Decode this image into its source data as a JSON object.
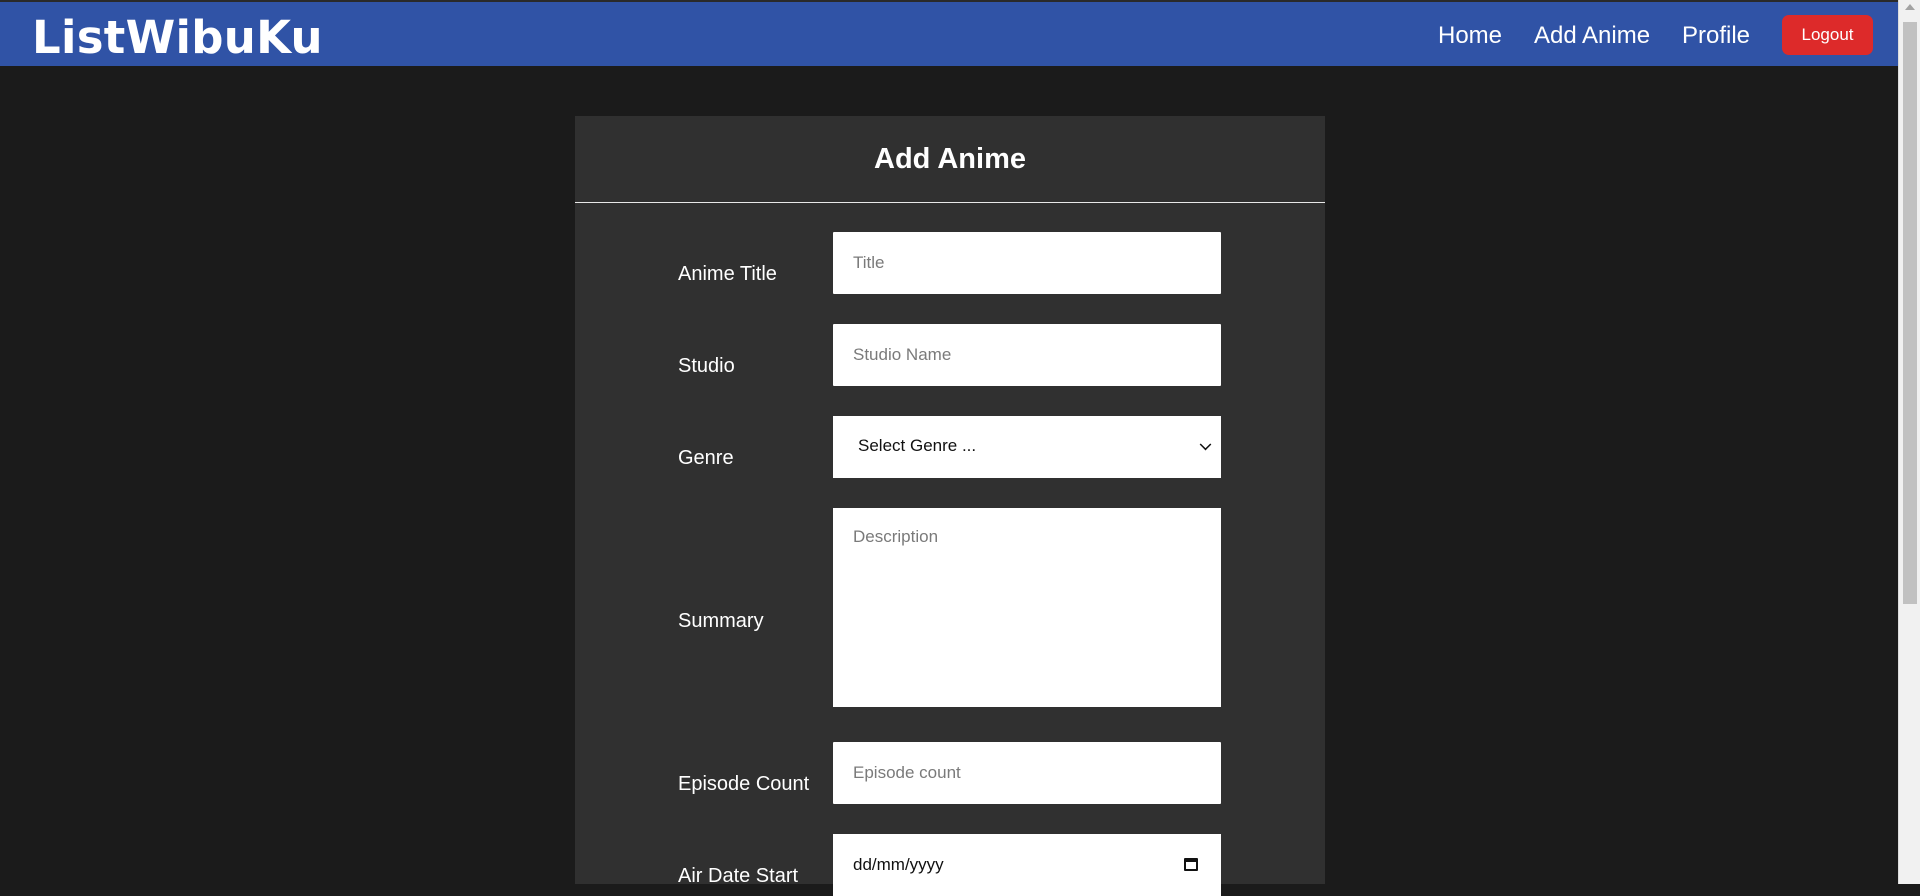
{
  "navbar": {
    "brand": "ListWibuKu",
    "links": [
      "Home",
      "Add Anime",
      "Profile"
    ],
    "logout_label": "Logout"
  },
  "form": {
    "title": "Add Anime",
    "fields": {
      "title": {
        "label": "Anime Title",
        "placeholder": "Title",
        "value": ""
      },
      "studio": {
        "label": "Studio",
        "placeholder": "Studio Name",
        "value": ""
      },
      "genre": {
        "label": "Genre",
        "selected": "Select Genre ..."
      },
      "summary": {
        "label": "Summary",
        "placeholder": "Description",
        "value": ""
      },
      "episodes": {
        "label": "Episode Count",
        "placeholder": "Episode count",
        "value": ""
      },
      "air_date_start": {
        "label": "Air Date Start",
        "value": "dd/mm/yyyy"
      }
    }
  },
  "icons": {
    "genre_dropdown": "chevron-down-icon",
    "date_picker": "calendar-icon"
  },
  "colors": {
    "navbar": "#3053a6",
    "background": "#1b1b1b",
    "card": "#303030",
    "logout": "#dd2a2a"
  }
}
